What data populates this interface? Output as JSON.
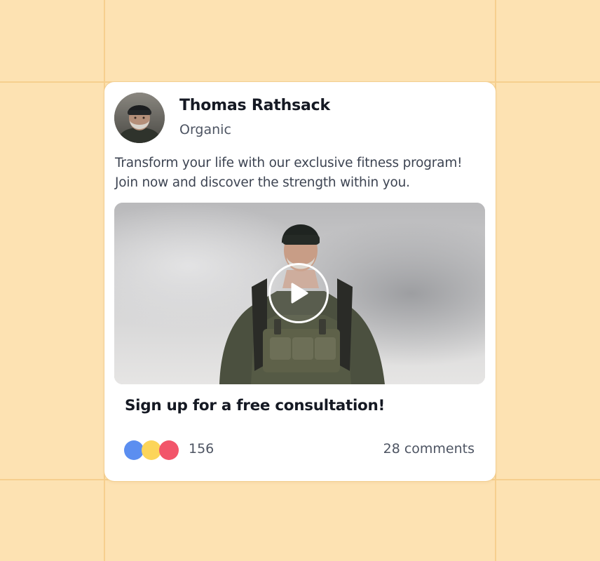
{
  "post": {
    "author": {
      "name": "Thomas Rathsack",
      "subtitle": "Organic"
    },
    "text_lines": [
      "Transform your life with our exclusive fitness program!",
      "Join now and discover the strength within you."
    ],
    "media": {
      "type": "video",
      "play_icon": "play-icon"
    },
    "cta_label": "Sign up for a free consultation!",
    "reactions": {
      "count": "156",
      "colors": [
        "#5b8ef0",
        "#fcd55a",
        "#f2556a"
      ]
    },
    "comments_label": "28 comments"
  },
  "colors": {
    "background": "#fde2b2",
    "grid": "#f6cf8e",
    "card": "#ffffff"
  }
}
